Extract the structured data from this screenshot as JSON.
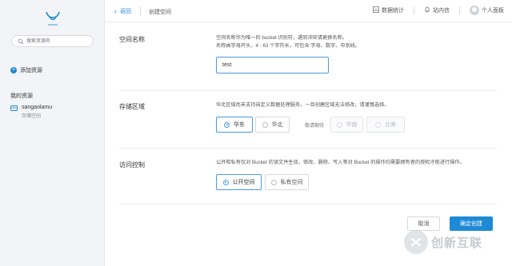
{
  "sidebar": {
    "search_placeholder": "搜索资源名",
    "add_resource_label": "添加资源",
    "my_resources_label": "我的资源",
    "bucket": {
      "name": "sangaolamu",
      "type": "存储空间"
    }
  },
  "topbar": {
    "back_label": "返回",
    "breadcrumb": "创建空间",
    "stats_label": "数据统计",
    "messages_label": "站内信",
    "panel_label": "个人面板"
  },
  "form": {
    "name_section": {
      "label": "空间名称",
      "desc_line1": "空间名称作为唯一的 bucket 识别符，遇到冲突请更换名称。",
      "desc_line2": "名称由字母开头，4 - 63 个字符长，可包含 字母、数字、中划线。",
      "value": "test"
    },
    "region_section": {
      "label": "存储区域",
      "desc": "华北区域尚未支持自定义数据处理服务，一旦创建区域无法修改，请谨慎选择。",
      "options": [
        "华东",
        "华北"
      ],
      "coming_label": "敬请期待",
      "disabled_options": [
        "华南",
        "北美"
      ]
    },
    "access_section": {
      "label": "访问控制",
      "desc": "公开和私有仅对 Bucket 的读文件生效，修改、删除、写入等对 Bucket 的操作均需要拥有者的授权才能进行操作。",
      "options": [
        "公开空间",
        "私有空间"
      ]
    },
    "cancel_label": "取消",
    "create_label": "确定创建"
  },
  "watermark": {
    "text": "创新互联"
  },
  "colors": {
    "accent": "#1e8ad6",
    "sidebar_bg": "#f2f4f7"
  }
}
